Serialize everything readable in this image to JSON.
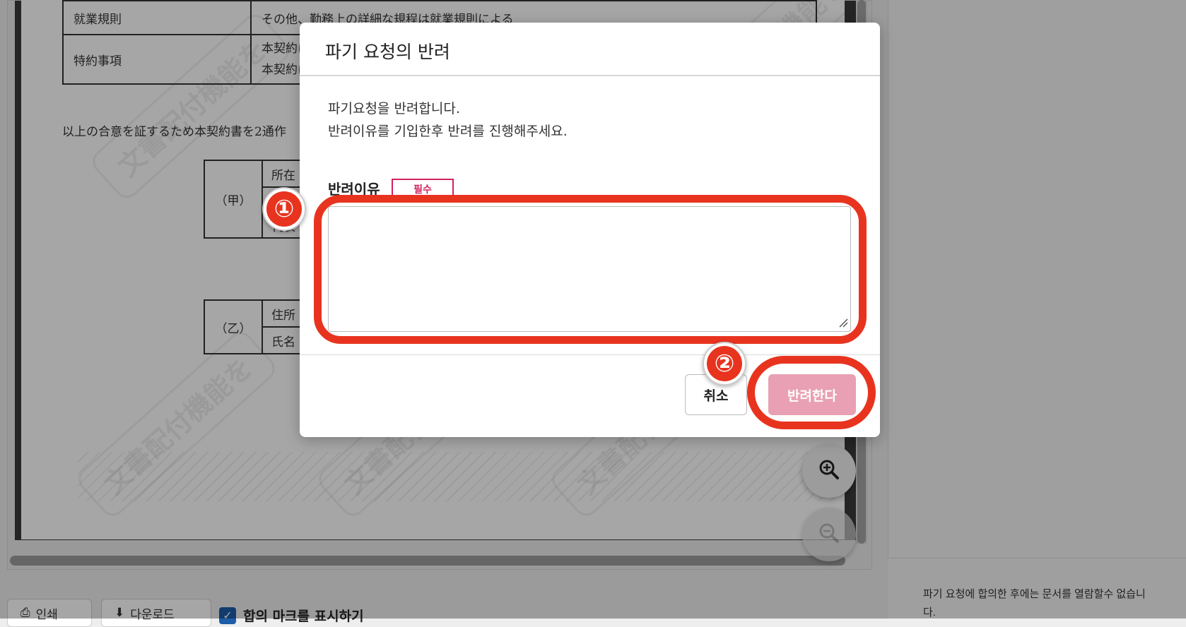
{
  "document": {
    "rows": [
      {
        "label": "就業規則",
        "value": "その他、勤務上の詳細な規程は就業規則による"
      },
      {
        "label": "特約事項",
        "value1": "本契約に",
        "value2": "本契約に"
      }
    ],
    "closing": "以上の合意を証するため本契約書を2通作",
    "party_a": {
      "label": "（甲）",
      "field1": "所在",
      "field2": "代表"
    },
    "party_b": {
      "label": "（乙）",
      "field1": "住所",
      "field2": "氏名"
    },
    "watermark_text": "文書配付機能をお試し利用中です"
  },
  "toolbar": {
    "print_label": "인쇄",
    "download_label": "다운로드",
    "show_agree_mark_label": "합의 마크를 표시하기",
    "show_agree_mark_checked": true
  },
  "right_panel": {
    "note": "파기 요청에 합의한 후에는 문서를 열람할수 없습니다."
  },
  "modal": {
    "title": "파기 요청의 반려",
    "message_line1": "파기요청을 반려합니다.",
    "message_line2": "반려이유를 기입한후 반려를 진행해주세요.",
    "reason_label": "반려이유",
    "required_badge": "필수",
    "reason_value": "",
    "cancel_label": "취소",
    "reject_label": "반려한다"
  },
  "annotations": {
    "step1": "①",
    "step2": "②",
    "highlight_color": "#e8341f"
  },
  "icons": [
    "zoom-in-icon",
    "zoom-out-icon",
    "print-icon",
    "download-icon",
    "checkbox-checked-icon"
  ]
}
